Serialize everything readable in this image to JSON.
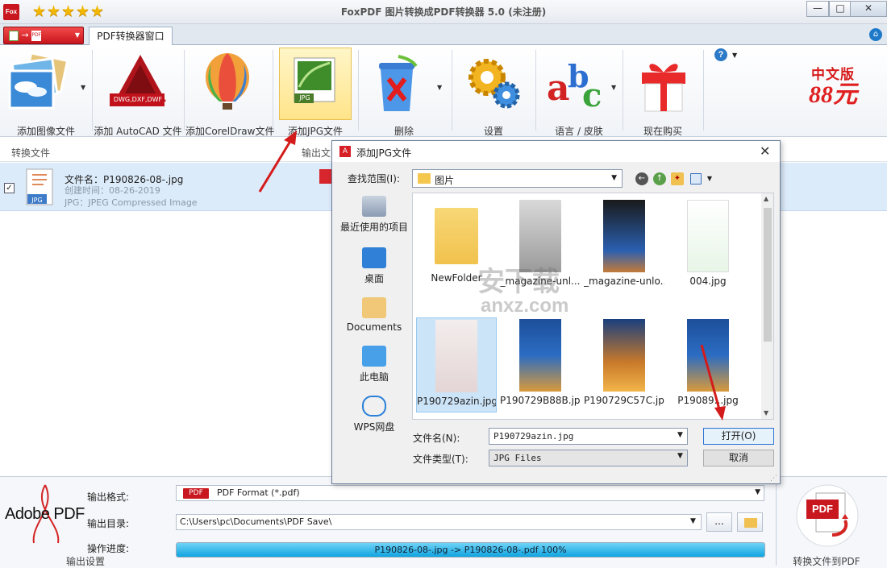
{
  "window": {
    "title": "FoxPDF 图片转换成PDF转换器 5.0 (未注册)",
    "app_icon": "Fox",
    "stars": [
      "★",
      "★",
      "★",
      "★",
      "★"
    ],
    "controls": {
      "minimize": "—",
      "maximize": "□",
      "close": "✕"
    }
  },
  "tabs": {
    "active_tab": "PDF转换器窗口",
    "convert_menu_arrow": "→",
    "convert_menu_pdf": "PDF",
    "home_glyph": "⌂"
  },
  "toolbar": {
    "items": [
      {
        "label": "添加图像文件",
        "icon": "image-stack-icon"
      },
      {
        "label": "添加 AutoCAD 文件",
        "icon": "autocad-icon",
        "badge": "DWG,DXF,DWF"
      },
      {
        "label": "添加CorelDraw文件",
        "icon": "balloon-icon"
      },
      {
        "label": "添加JPG文件",
        "icon": "jpg-icon",
        "badge": "JPG"
      },
      {
        "label": "删除",
        "icon": "recycle-bin-icon"
      },
      {
        "label": "设置",
        "icon": "gears-icon"
      },
      {
        "label": "语言 / 皮肤",
        "icon": "abc-icon"
      },
      {
        "label": "现在购买",
        "icon": "gift-icon"
      }
    ],
    "help_glyph": "?",
    "promo_line1": "中文版",
    "promo_line2": "88元"
  },
  "file_list": {
    "col_convert": "转换文件",
    "col_output": "输出文",
    "rows": [
      {
        "checked": "✓",
        "thumb_badge": "JPG",
        "name": "文件名：P190826-08-.jpg",
        "created": "创建时间：08-26-2019",
        "type": "JPG：JPEG Compressed Image"
      }
    ]
  },
  "dialog": {
    "title": "添加JPG文件",
    "close": "✕",
    "lookin_label": "查找范围(I):",
    "lookin_value": "图片",
    "places": [
      "最近使用的项目",
      "桌面",
      "Documents",
      "此电脑",
      "WPS网盘"
    ],
    "files": [
      {
        "name": "NewFolder",
        "kind": "folder"
      },
      {
        "name": "_magazine-unl...",
        "kind": "image"
      },
      {
        "name": "_magazine-unlo...",
        "kind": "image"
      },
      {
        "name": "004.jpg",
        "kind": "image"
      },
      {
        "name": "P190729azin.jpg",
        "kind": "image",
        "selected": true
      },
      {
        "name": "P190729B88B.jpg",
        "kind": "image"
      },
      {
        "name": "P190729C57C.jpg",
        "kind": "image"
      },
      {
        "name": "P19089...jpg",
        "kind": "image"
      }
    ],
    "filename_label": "文件名(N):",
    "filename_value": "P190729azin.jpg",
    "filetype_label": "文件类型(T):",
    "filetype_value": "JPG Files",
    "open_button": "打开(O)",
    "cancel_button": "取消",
    "watermark_line1": "安下载",
    "watermark_line2": "anxz.com"
  },
  "bottom": {
    "adobe_logo": "Adobe PDF",
    "output_settings": "输出设置",
    "format_label": "输出格式:",
    "format_badge": "PDF",
    "format_value": "PDF Format (*.pdf)",
    "dir_label": "输出目录:",
    "dir_value": "C:\\Users\\pc\\Documents\\PDF Save\\",
    "browse_label": "...",
    "progress_label": "操作进度:",
    "progress_text": "P190826-08-.jpg -> P190826-08-.pdf 100%",
    "progress_percent": 100,
    "convert_badge": "PDF",
    "convert_label": "转换文件到PDF"
  },
  "colors": {
    "accent_red": "#c8171f",
    "selection_blue": "#dcebfa",
    "progress_blue": "#10a4e0",
    "annotation_arrow": "#d41b1b"
  }
}
